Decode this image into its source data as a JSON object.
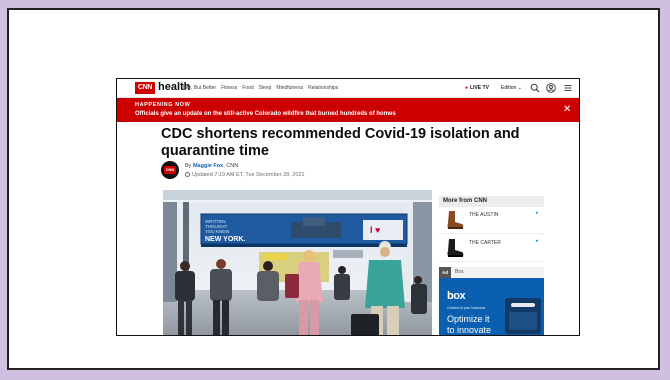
{
  "nav": {
    "logo": "CNN",
    "brand": "health",
    "links": [
      "Life, But Better",
      "Fitness",
      "Food",
      "Sleep",
      "Mindfulness",
      "Relationships"
    ],
    "live_tv": "LIVE TV",
    "edition": "Edition"
  },
  "banner": {
    "label": "HAPPENING NOW",
    "text": "Officials give an update on the still-active Colorado wildfire that burned hundreds of homes"
  },
  "article": {
    "headline": "CDC shortens recommended Covid-19 isolation and quarantine time",
    "by": "By",
    "author": "Maggie Fox",
    "outlet": ", CNN",
    "updated": "Updated 7:19 AM ET, Tue December 28, 2021",
    "photo_sign": [
      "WRITTEN",
      "THOUGHT",
      "YOU KNEW",
      "NEW YORK."
    ]
  },
  "sidebar": {
    "title": "More from CNN",
    "items": [
      {
        "label": "THE AUSTIN"
      },
      {
        "label": "THE CARTER"
      }
    ],
    "ad_tag": "Ad",
    "ad_name": "Box",
    "ad_logo": "box",
    "ad_sub": "Content is your business",
    "ad_headline": [
      "Optimize it",
      "to innovate"
    ]
  }
}
